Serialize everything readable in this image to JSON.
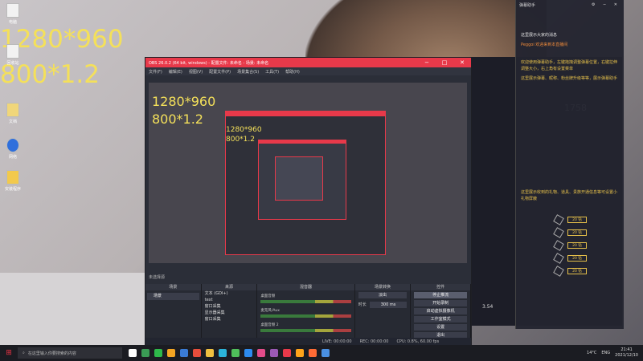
{
  "desktop": {
    "overlay_line1": "1280*960",
    "overlay_line2": "800*1.2",
    "icons": [
      {
        "label": "电脑",
        "color": "#f2f2f2"
      },
      {
        "label": "回收站",
        "color": "#e9e9e9"
      },
      {
        "label": "文档",
        "color": "#f0d67a"
      },
      {
        "label": "文档",
        "color": "#f6f6f6"
      },
      {
        "label": "网络",
        "color": "#2f6fdc"
      },
      {
        "label": "安装程序",
        "color": "#f2c94c"
      }
    ]
  },
  "obs": {
    "title": "OBS 26.0.2 (64 bit, windows) - 配置文件: 未命名 - 场景: 未命名",
    "menu": [
      "文件(F)",
      "编辑(E)",
      "视图(V)",
      "配置文件(P)",
      "场景集合(S)",
      "工具(T)",
      "帮助(H)"
    ],
    "preview_text1": "1280*960",
    "preview_text2": "800*1.2",
    "inner_text1": "1280*960",
    "inner_text2": "800*1.2",
    "no_source": "未选择源",
    "dock_titles": {
      "scenes": "场景",
      "sources": "来源",
      "mixer": "混音器",
      "transitions": "场景转换",
      "controls": "控件"
    },
    "scenes": [
      "场景"
    ],
    "sources": [
      "文本 (GDI+)",
      "text",
      "窗口采集",
      "显示器采集",
      "窗口采集"
    ],
    "mixer": [
      "桌面音频",
      "麦克风/Aux",
      "桌面音频 2"
    ],
    "transition_name": "淡出",
    "transition_duration_label": "时长",
    "transition_duration": "300 ms",
    "controls": [
      "停止推流",
      "开始录制",
      "启动虚拟摄像机",
      "工作室模式",
      "设置",
      "退出"
    ],
    "status": {
      "live": "LIVE: 00:00:00",
      "rec": "REC: 00:00:00",
      "cpu": "CPU: 0.8%, 60.00 fps"
    }
  },
  "client": {
    "hdr_title": "弹幕助手",
    "chat": [
      {
        "text": "这里展示大家的消息",
        "cls": "w"
      },
      {
        "text": "Peggoi 欢迎来到本直播间",
        "cls": "p"
      },
      {
        "text": "欢迎使用弹幕助手，左键拖拽调整弹幕位置，右键拉伸调整大小，右上角有设置菜单",
        "cls": ""
      },
      {
        "text": "这里展示弹幕、昵称、粉丝牌升级等等，展示弹幕助手",
        "cls": ""
      }
    ],
    "score": "1758",
    "gift_notice": "这里展示收到的礼物、道具、贵族开通信息等可设置小礼物屏蔽",
    "gift_btn": "20 钻",
    "small_score": "3.54"
  },
  "taskbar": {
    "search_placeholder": "在这里输入你要搜索的内容",
    "weather": "14°C",
    "lang": "ENG",
    "time": "21:41",
    "date": "2021/12/10",
    "icon_colors": [
      "#ffffff",
      "#3a9b55",
      "#2eb84a",
      "#f5a623",
      "#3a7bd5",
      "#e84e3c",
      "#f0c040",
      "#2bb3d9",
      "#4fbf5a",
      "#2d8cf0",
      "#e44c8a",
      "#9b59b6",
      "#e8394a",
      "#ffa31a",
      "#ff6b35",
      "#4a90e2"
    ]
  }
}
